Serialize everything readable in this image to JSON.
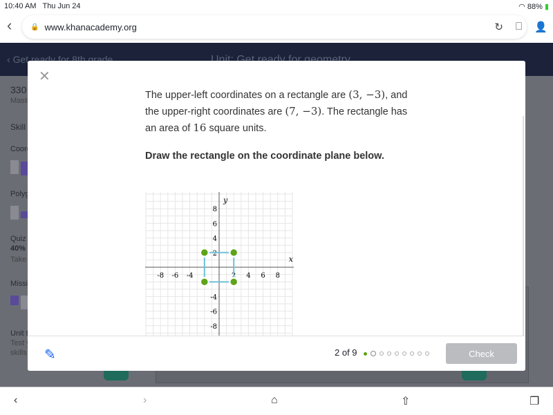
{
  "status": {
    "time": "10:40 AM",
    "date": "Thu Jun 24",
    "battery": "88%"
  },
  "browser": {
    "url": "www.khanacademy.org"
  },
  "header": {
    "breadcrumb": "Get ready for 8th grade",
    "unit": "Unit: Get ready for geometry"
  },
  "sidebar": {
    "score": "330",
    "mastery": "Maste",
    "skill": "Skill",
    "coord": "Coord",
    "polyg": "Polyg",
    "quiz": "Quiz",
    "quiz_pct": "40%",
    "take": "Take",
    "missing": "Missi",
    "unit_test": "Unit t",
    "test_y": "Test y",
    "skills": "skills"
  },
  "question": {
    "line1_pre": "The upper-left coordinates on a rectangle are ",
    "p1": "(3, −3)",
    "line1_post": ", and",
    "line2_pre": "the upper-right coordinates are ",
    "p2": "(7, −3)",
    "line2_post": ". The rectangle has",
    "line3_pre": "an area of ",
    "area": "16",
    "line3_post": " square units.",
    "instruction": "Draw the rectangle on the coordinate plane below."
  },
  "graph": {
    "xlabel": "x",
    "ylabel": "y",
    "xticks": [
      -8,
      -6,
      -4,
      2,
      4,
      6,
      8
    ],
    "yticks": [
      8,
      6,
      4,
      2,
      -4,
      -6,
      -8
    ],
    "range": [
      -10,
      10
    ],
    "points": [
      [
        -2,
        2
      ],
      [
        2,
        2
      ],
      [
        2,
        -2
      ],
      [
        -2,
        -2
      ]
    ],
    "point_color": "#5fa319",
    "rect_color": "#6bc0d8"
  },
  "footer": {
    "progress": "2 of 9",
    "current": 2,
    "total": 9,
    "check": "Check"
  },
  "colors": {
    "header": "#1b2239",
    "accent": "#1865f2"
  }
}
